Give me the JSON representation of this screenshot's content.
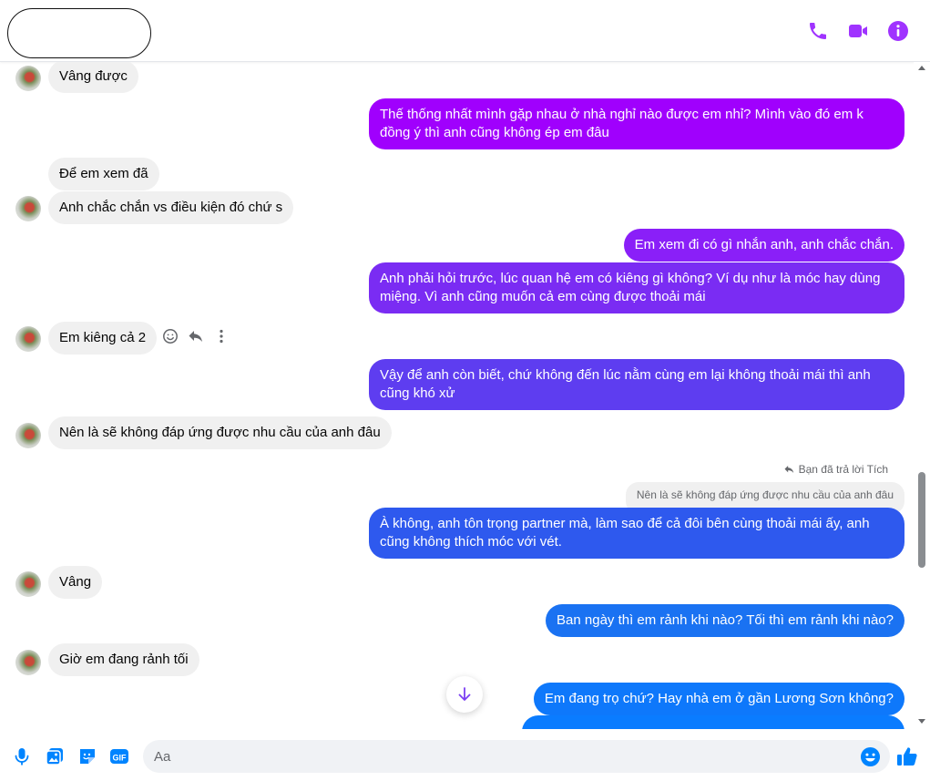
{
  "colors": {
    "accent": "#0084ff",
    "header_icon": "#a033ff",
    "gradient": [
      "#a000ff",
      "#7b2cf5",
      "#5b3ff0",
      "#2e5cf0",
      "#1877f2",
      "#0a7cff"
    ]
  },
  "header": {
    "icons": [
      "phone-icon",
      "video-camera-icon",
      "info-icon"
    ]
  },
  "messages": [
    {
      "side": "in",
      "text": "Vâng được"
    },
    {
      "side": "out",
      "text": "Thế thống nhất mình gặp nhau ở nhà nghỉ nào được em nhỉ? Mình vào đó em k đồng ý thì anh cũng không ép em đâu"
    },
    {
      "side": "in",
      "text": "Để em xem đã"
    },
    {
      "side": "in",
      "text": "Anh chắc chắn vs điều kiện đó chứ s"
    },
    {
      "side": "out",
      "text": "Em xem đi có gì nhắn anh, anh chắc chắn."
    },
    {
      "side": "out",
      "text": "Anh phải hỏi trước, lúc quan hệ em có kiêng gì không? Ví dụ như là móc hay dùng miệng. Vì anh cũng muốn cả em cùng được thoải mái"
    },
    {
      "side": "in",
      "text": "Em kiêng cả 2"
    },
    {
      "side": "out",
      "text": "Vậy để anh còn biết, chứ không đến lúc nằm cùng em lại không thoải mái thì anh cũng khó xử"
    },
    {
      "side": "in",
      "text": "Nên là sẽ không đáp ứng được nhu cầu của anh đâu"
    },
    {
      "side": "out",
      "text": "À không, anh tôn trọng partner mà, làm sao để cả đôi bên cùng thoải mái ấy, anh cũng không thích móc với vét."
    },
    {
      "side": "in",
      "text": "Vâng"
    },
    {
      "side": "out",
      "text": "Ban ngày thì em rảnh khi nào? Tối thì em rảnh khi nào?"
    },
    {
      "side": "in",
      "text": "Giờ em đang rảnh tối"
    },
    {
      "side": "out",
      "text": "Em đang trọ chứ? Hay nhà em ở gần Lương Sơn không?"
    }
  ],
  "reply": {
    "label": "Bạn đã trả lời Tích",
    "quoted": "Nên là sẽ không đáp ứng được nhu cầu của anh đâu"
  },
  "message_actions": [
    "smile-icon",
    "reply-icon",
    "more-icon"
  ],
  "composer": {
    "placeholder": "Aa",
    "icons": [
      "microphone-icon",
      "gallery-icon",
      "sticker-icon",
      "gif-icon",
      "emoji-icon",
      "like-icon"
    ],
    "gif_label": "GIF"
  }
}
